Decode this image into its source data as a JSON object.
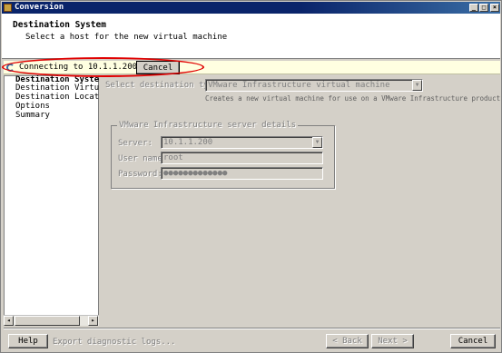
{
  "window": {
    "title": "Conversion",
    "controls": {
      "minimize": "_",
      "maximize": "□",
      "close": "×"
    }
  },
  "header": {
    "title": "Destination System",
    "subtitle": "Select a host for the new virtual machine"
  },
  "connecting": {
    "text": "Connecting to 10.1.1.200...",
    "cancel_label": "Cancel",
    "icon": "spinner-icon",
    "highlight_color": "#e00000"
  },
  "nav": {
    "items": [
      {
        "label": "Destination System",
        "active": true
      },
      {
        "label": "Destination Virtual M",
        "active": false
      },
      {
        "label": "Destination Location",
        "active": false
      },
      {
        "label": "Options",
        "active": false
      },
      {
        "label": "Summary",
        "active": false
      }
    ],
    "scroll_left": "◂",
    "scroll_right": "▸"
  },
  "form": {
    "dest_type_label": "Select destination type:",
    "dest_type_value": "VMware Infrastructure virtual machine",
    "dest_type_hint": "Creates a new virtual machine for use on a VMware Infrastructure product",
    "group_title": "VMware Infrastructure server details",
    "server_label": "Server:",
    "server_value": "10.1.1.200",
    "username_label": "User name:",
    "username_value": "root",
    "password_label": "Password:",
    "password_value": "●●●●●●●●●●●●●"
  },
  "footer": {
    "help_label": "Help",
    "export_label": "Export diagnostic logs...",
    "back_label": "< Back",
    "next_label": "Next >",
    "cancel_label": "Cancel"
  },
  "colors": {
    "titlebar": "#0a246a",
    "face": "#d4d0c8",
    "tooltip_bg": "#ffffe1"
  }
}
